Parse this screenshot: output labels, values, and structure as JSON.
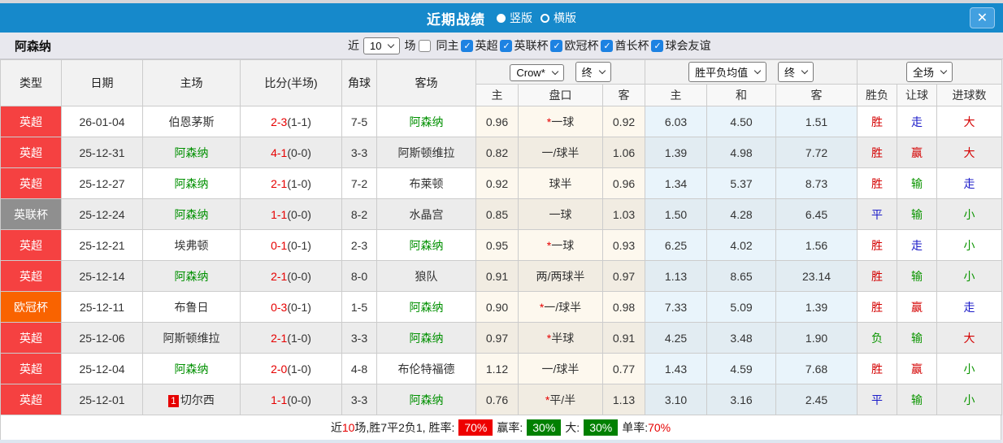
{
  "titlebar": {
    "title": "近期战绩",
    "radio_vertical": "竖版",
    "radio_horizontal": "横版"
  },
  "icons": {
    "close": "✕",
    "check": "✓",
    "chevron": "chevron-down-css-shape",
    "radio_selected": "filled-circle",
    "radio_unselected": "hollow-circle"
  },
  "filter": {
    "team": "阿森纳",
    "near_label": "近",
    "count_value": "10",
    "matches_label": "场",
    "same_home_label": "同主",
    "leagues": [
      "英超",
      "英联杯",
      "欧冠杯",
      "酋长杯",
      "球会友谊"
    ],
    "leagues_checked": [
      true,
      true,
      true,
      true,
      true
    ],
    "same_home_checked": false
  },
  "table": {
    "headers": [
      "类型",
      "日期",
      "主场",
      "比分(半场)",
      "角球",
      "客场"
    ],
    "selects": {
      "bookmaker": "Crow*",
      "bookmaker_period": "终",
      "avg": "胜平负均值",
      "avg_period": "终",
      "scope": "全场"
    },
    "subheaders": [
      "主",
      "盘口",
      "客",
      "主",
      "和",
      "客",
      "胜负",
      "让球",
      "进球数"
    ],
    "rows": [
      {
        "type": "英超",
        "tc": "epl",
        "date": "26-01-04",
        "home": "伯恩茅斯",
        "hg": false,
        "hb": "",
        "score": "2-3",
        "half": "(1-1)",
        "corner": "7-5",
        "away": "阿森纳",
        "ag": true,
        "o1": "0.96",
        "star": true,
        "line": "一球",
        "o2": "0.92",
        "a1": "6.03",
        "a2": "4.50",
        "a3": "1.51",
        "r1": [
          "胜",
          "r"
        ],
        "r2": [
          "走",
          "b"
        ],
        "r3": [
          "大",
          "r"
        ]
      },
      {
        "type": "英超",
        "tc": "epl",
        "date": "25-12-31",
        "home": "阿森纳",
        "hg": true,
        "hb": "",
        "score": "4-1",
        "half": "(0-0)",
        "corner": "3-3",
        "away": "阿斯顿维拉",
        "ag": false,
        "o1": "0.82",
        "star": false,
        "line": "一/球半",
        "o2": "1.06",
        "a1": "1.39",
        "a2": "4.98",
        "a3": "7.72",
        "r1": [
          "胜",
          "r"
        ],
        "r2": [
          "赢",
          "r"
        ],
        "r3": [
          "大",
          "r"
        ]
      },
      {
        "type": "英超",
        "tc": "epl",
        "date": "25-12-27",
        "home": "阿森纳",
        "hg": true,
        "hb": "",
        "score": "2-1",
        "half": "(1-0)",
        "corner": "7-2",
        "away": "布莱顿",
        "ag": false,
        "o1": "0.92",
        "star": false,
        "line": "球半",
        "o2": "0.96",
        "a1": "1.34",
        "a2": "5.37",
        "a3": "8.73",
        "r1": [
          "胜",
          "r"
        ],
        "r2": [
          "输",
          "g"
        ],
        "r3": [
          "走",
          "b"
        ]
      },
      {
        "type": "英联杯",
        "tc": "cup",
        "date": "25-12-24",
        "home": "阿森纳",
        "hg": true,
        "hb": "",
        "score": "1-1",
        "half": "(0-0)",
        "corner": "8-2",
        "away": "水晶宫",
        "ag": false,
        "o1": "0.85",
        "star": false,
        "line": "一球",
        "o2": "1.03",
        "a1": "1.50",
        "a2": "4.28",
        "a3": "6.45",
        "r1": [
          "平",
          "b"
        ],
        "r2": [
          "输",
          "g"
        ],
        "r3": [
          "小",
          "g"
        ]
      },
      {
        "type": "英超",
        "tc": "epl",
        "date": "25-12-21",
        "home": "埃弗顿",
        "hg": false,
        "hb": "",
        "score": "0-1",
        "half": "(0-1)",
        "corner": "2-3",
        "away": "阿森纳",
        "ag": true,
        "o1": "0.95",
        "star": true,
        "line": "一球",
        "o2": "0.93",
        "a1": "6.25",
        "a2": "4.02",
        "a3": "1.56",
        "r1": [
          "胜",
          "r"
        ],
        "r2": [
          "走",
          "b"
        ],
        "r3": [
          "小",
          "g"
        ]
      },
      {
        "type": "英超",
        "tc": "epl",
        "date": "25-12-14",
        "home": "阿森纳",
        "hg": true,
        "hb": "",
        "score": "2-1",
        "half": "(0-0)",
        "corner": "8-0",
        "away": "狼队",
        "ag": false,
        "o1": "0.91",
        "star": false,
        "line": "两/两球半",
        "o2": "0.97",
        "a1": "1.13",
        "a2": "8.65",
        "a3": "23.14",
        "r1": [
          "胜",
          "r"
        ],
        "r2": [
          "输",
          "g"
        ],
        "r3": [
          "小",
          "g"
        ]
      },
      {
        "type": "欧冠杯",
        "tc": "ucl",
        "date": "25-12-11",
        "home": "布鲁日",
        "hg": false,
        "hb": "",
        "score": "0-3",
        "half": "(0-1)",
        "corner": "1-5",
        "away": "阿森纳",
        "ag": true,
        "o1": "0.90",
        "star": true,
        "line": "一/球半",
        "o2": "0.98",
        "a1": "7.33",
        "a2": "5.09",
        "a3": "1.39",
        "r1": [
          "胜",
          "r"
        ],
        "r2": [
          "赢",
          "r"
        ],
        "r3": [
          "走",
          "b"
        ]
      },
      {
        "type": "英超",
        "tc": "epl",
        "date": "25-12-06",
        "home": "阿斯顿维拉",
        "hg": false,
        "hb": "",
        "score": "2-1",
        "half": "(1-0)",
        "corner": "3-3",
        "away": "阿森纳",
        "ag": true,
        "o1": "0.97",
        "star": true,
        "line": "半球",
        "o2": "0.91",
        "a1": "4.25",
        "a2": "3.48",
        "a3": "1.90",
        "r1": [
          "负",
          "g"
        ],
        "r2": [
          "输",
          "g"
        ],
        "r3": [
          "大",
          "r"
        ]
      },
      {
        "type": "英超",
        "tc": "epl",
        "date": "25-12-04",
        "home": "阿森纳",
        "hg": true,
        "hb": "",
        "score": "2-0",
        "half": "(1-0)",
        "corner": "4-8",
        "away": "布伦特福德",
        "ag": false,
        "o1": "1.12",
        "star": false,
        "line": "一/球半",
        "o2": "0.77",
        "a1": "1.43",
        "a2": "4.59",
        "a3": "7.68",
        "r1": [
          "胜",
          "r"
        ],
        "r2": [
          "赢",
          "r"
        ],
        "r3": [
          "小",
          "g"
        ]
      },
      {
        "type": "英超",
        "tc": "epl",
        "date": "25-12-01",
        "home": "切尔西",
        "hg": false,
        "hb": "1",
        "score": "1-1",
        "half": "(0-0)",
        "corner": "3-3",
        "away": "阿森纳",
        "ag": true,
        "o1": "0.76",
        "star": true,
        "line": "平/半",
        "o2": "1.13",
        "a1": "3.10",
        "a2": "3.16",
        "a3": "2.45",
        "r1": [
          "平",
          "b"
        ],
        "r2": [
          "输",
          "g"
        ],
        "r3": [
          "小",
          "g"
        ]
      }
    ]
  },
  "footer": {
    "near_label": "近",
    "count": "10",
    "summary": "场,胜7平2负1, 胜率:",
    "win_pct": "70%",
    "win_rate_label": "赢率:",
    "win_rate": "30%",
    "big_label": "大:",
    "big_rate": "30%",
    "single_label": "单率:",
    "single_rate": "70%"
  },
  "colors": {
    "titlebar_bg": "#1689cb",
    "close_btn_bg": "#42a0e0",
    "epl_badge": "#f54141",
    "league_cup_badge": "#8f8f8f",
    "ucl_badge": "#f96300",
    "score_red": "#e60000",
    "team_green": "#009000",
    "result_red": "#d40000",
    "result_blue": "#1d1dc9",
    "result_green": "#0b9500",
    "crow_col_bg": "#fdf8ee",
    "avg_col_bg": "#e9f4fb",
    "win_pct_badge_bg": "#ee0000",
    "rate_badge_bg": "#008000",
    "checkbox_blue": "#1d82e2"
  }
}
